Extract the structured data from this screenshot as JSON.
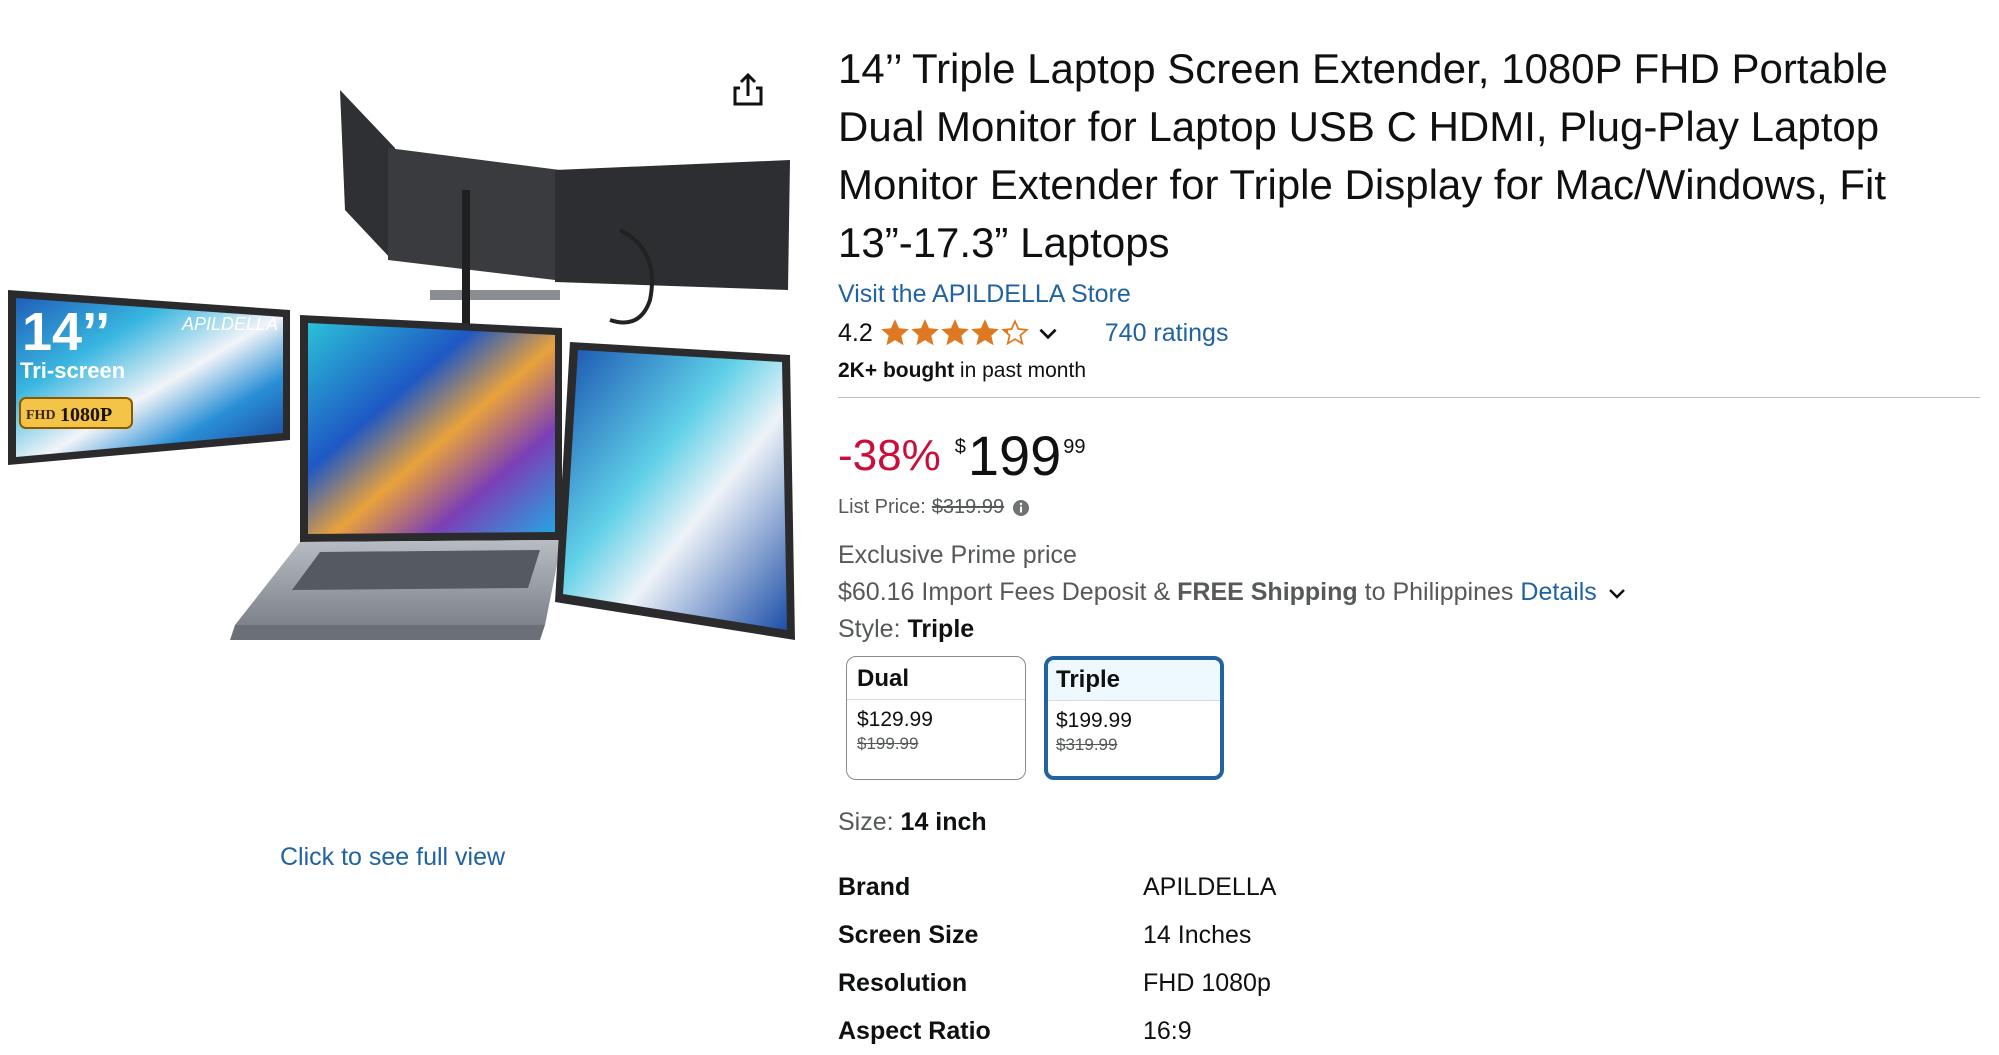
{
  "product": {
    "title": "14’’ Triple Laptop Screen Extender, 1080P FHD Portable Dual Monitor for Laptop USB C HDMI, Plug-Play Laptop Monitor Extender for Triple Display for Mac/Windows, Fit 13”-17.3” Laptops",
    "store_link": "Visit the APILDELLA Store",
    "rating": "4.2",
    "rating_stars": 4.2,
    "ratings_count": "740 ratings",
    "bought_bold": "2K+ bought",
    "bought_rest": "in past month"
  },
  "image": {
    "overlay_size": "14’’",
    "overlay_brand": "APILDELLA",
    "overlay_mode": "Tri-screen",
    "overlay_fhd": "FHD",
    "overlay_res": "1080P",
    "full_view_label": "Click to see full view"
  },
  "price": {
    "discount": "-38%",
    "currency": "$",
    "whole": "199",
    "fraction": "99",
    "list_label": "List Price:",
    "list_value": "$319.99"
  },
  "shipping": {
    "prime_text": "Exclusive Prime price",
    "fee": "$60.16 Import Fees Deposit &",
    "free": "FREE Shipping",
    "to": "to Philippines",
    "details": "Details"
  },
  "style": {
    "label": "Style:",
    "selected": "Triple",
    "options": [
      {
        "name": "Dual",
        "price": "$129.99",
        "list": "$199.99"
      },
      {
        "name": "Triple",
        "price": "$199.99",
        "list": "$319.99"
      }
    ]
  },
  "size": {
    "label": "Size:",
    "value": "14 inch"
  },
  "specs": [
    {
      "key": "Brand",
      "value": "APILDELLA"
    },
    {
      "key": "Screen Size",
      "value": "14 Inches"
    },
    {
      "key": "Resolution",
      "value": "FHD 1080p"
    },
    {
      "key": "Aspect Ratio",
      "value": "16:9"
    }
  ],
  "colors": {
    "link": "#2162a1",
    "discount": "#cc0c39",
    "star": "#de7921",
    "selected_border": "#2162a1"
  }
}
